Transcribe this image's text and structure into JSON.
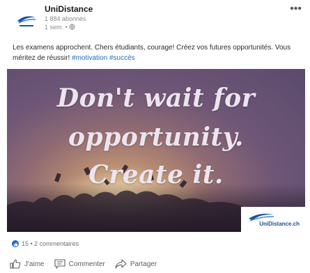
{
  "post": {
    "author": {
      "name": "UniDistance",
      "followers": "1 884 abonnés",
      "time": "1 sem. •",
      "avatar_icon": "unidistance-logo-icon"
    },
    "more_icon": "more-dots-icon",
    "more_label": "•••",
    "text": {
      "body": "Les examens approchent. Chers étudiants, courage! Créez vos futures opportunités. Vous méritez de réussir!",
      "hashtags": [
        "#motivation",
        "#succès"
      ]
    },
    "image": {
      "quote_lines": [
        "Don't wait for",
        "opportunity.",
        "Create it."
      ],
      "brand_label": "UniDistance.ch"
    },
    "social": {
      "reactions": "15 • 2 commentaires",
      "like_icon": "like-reaction-icon"
    },
    "actions": [
      {
        "label": "J'aime",
        "icon": "thumbs-up-icon"
      },
      {
        "label": "Commenter",
        "icon": "comment-icon"
      },
      {
        "label": "Partager",
        "icon": "share-icon"
      }
    ],
    "colors": {
      "accent": "#1f6bbf",
      "brand": "#1c4f9b",
      "text": "#2b2b2b",
      "muted": "#8a8a8a"
    }
  }
}
